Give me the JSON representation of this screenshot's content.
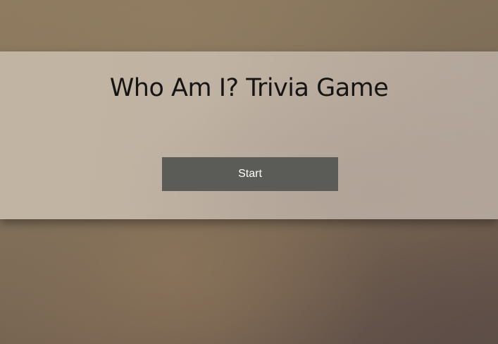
{
  "game": {
    "title": "Who Am I? Trivia Game",
    "start_label": "Start"
  },
  "colors": {
    "panel": "#c0b3a3",
    "button": "#5b5b57",
    "button_text": "#ffffff",
    "title_text": "#161513"
  }
}
